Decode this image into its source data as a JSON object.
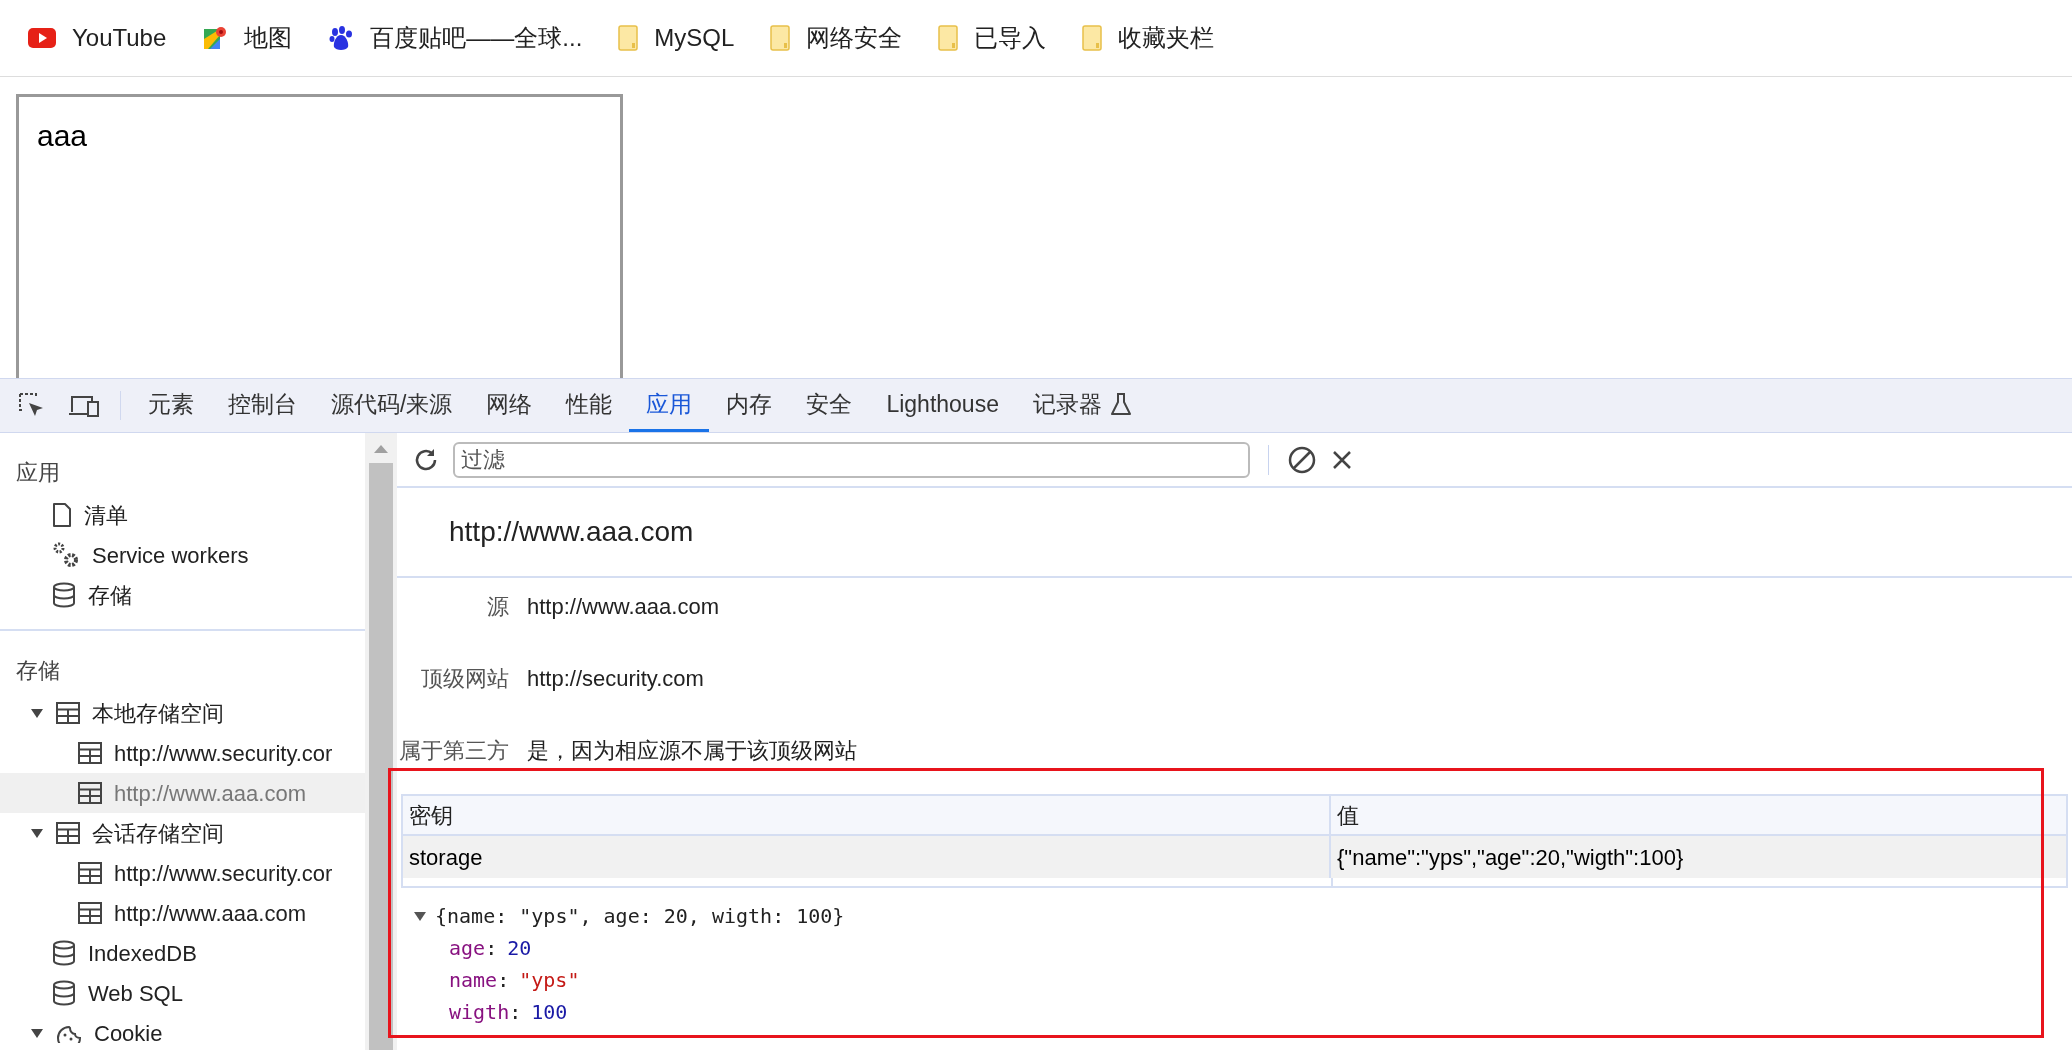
{
  "bookmarks": [
    {
      "label": "YouTube",
      "kind": "youtube"
    },
    {
      "label": "地图",
      "kind": "maps"
    },
    {
      "label": "百度贴吧——全球...",
      "kind": "baidu"
    },
    {
      "label": "MySQL",
      "kind": "folder"
    },
    {
      "label": "网络安全",
      "kind": "folder"
    },
    {
      "label": "已导入",
      "kind": "folder"
    },
    {
      "label": "收藏夹栏",
      "kind": "folder"
    }
  ],
  "page": {
    "textarea_value": "aaa"
  },
  "devtools": {
    "tabs": [
      {
        "label": "元素",
        "selected": false,
        "experimental": false
      },
      {
        "label": "控制台",
        "selected": false,
        "experimental": false
      },
      {
        "label": "源代码/来源",
        "selected": false,
        "experimental": false
      },
      {
        "label": "网络",
        "selected": false,
        "experimental": false
      },
      {
        "label": "性能",
        "selected": false,
        "experimental": false
      },
      {
        "label": "应用",
        "selected": true,
        "experimental": false
      },
      {
        "label": "内存",
        "selected": false,
        "experimental": false
      },
      {
        "label": "安全",
        "selected": false,
        "experimental": false
      },
      {
        "label": "Lighthouse",
        "selected": false,
        "experimental": false
      },
      {
        "label": "记录器",
        "selected": false,
        "experimental": true
      }
    ]
  },
  "sidebar": {
    "sections": [
      {
        "title": "应用",
        "items": [
          {
            "label": "清单",
            "kind": "file",
            "selected": false
          },
          {
            "label": "Service workers",
            "kind": "gears",
            "selected": false
          },
          {
            "label": "存储",
            "kind": "database",
            "selected": false
          }
        ]
      },
      {
        "title": "存储",
        "items": [
          {
            "label": "本地存储空间",
            "kind": "table",
            "expanded": true,
            "selected": false,
            "children": [
              {
                "label": "http://www.security.cor",
                "kind": "table",
                "selected": false
              },
              {
                "label": "http://www.aaa.com",
                "kind": "table",
                "selected": true
              }
            ]
          },
          {
            "label": "会话存储空间",
            "kind": "table",
            "expanded": true,
            "selected": false,
            "children": [
              {
                "label": "http://www.security.cor",
                "kind": "table",
                "selected": false
              },
              {
                "label": "http://www.aaa.com",
                "kind": "table",
                "selected": false
              }
            ]
          },
          {
            "label": "IndexedDB",
            "kind": "database",
            "selected": false
          },
          {
            "label": "Web SQL",
            "kind": "database",
            "selected": false
          },
          {
            "label": "Cookie",
            "kind": "cookie",
            "expanded": true,
            "selected": false
          }
        ]
      }
    ]
  },
  "main": {
    "filter": {
      "placeholder": "过滤"
    },
    "origin_title": "http://www.aaa.com",
    "info": [
      {
        "label": "源",
        "value": "http://www.aaa.com"
      },
      {
        "label": "顶级网站",
        "value": "http://security.com"
      },
      {
        "label": "属于第三方",
        "value": "是，因为相应源不属于该顶级网站"
      }
    ],
    "table": {
      "columns": [
        "密钥",
        "值"
      ],
      "rows": [
        {
          "key": "storage",
          "value": "{\"name\":\"yps\",\"age\":20,\"wigth\":100}",
          "selected": true
        }
      ]
    },
    "preview": {
      "summary": "{name: \"yps\", age: 20, wigth: 100}",
      "expanded": true,
      "separator": ":",
      "properties": [
        {
          "key": "age",
          "value": "20",
          "kind": "number"
        },
        {
          "key": "name",
          "value": "\"yps\"",
          "kind": "string"
        },
        {
          "key": "wigth",
          "value": "100",
          "kind": "number"
        }
      ]
    }
  }
}
